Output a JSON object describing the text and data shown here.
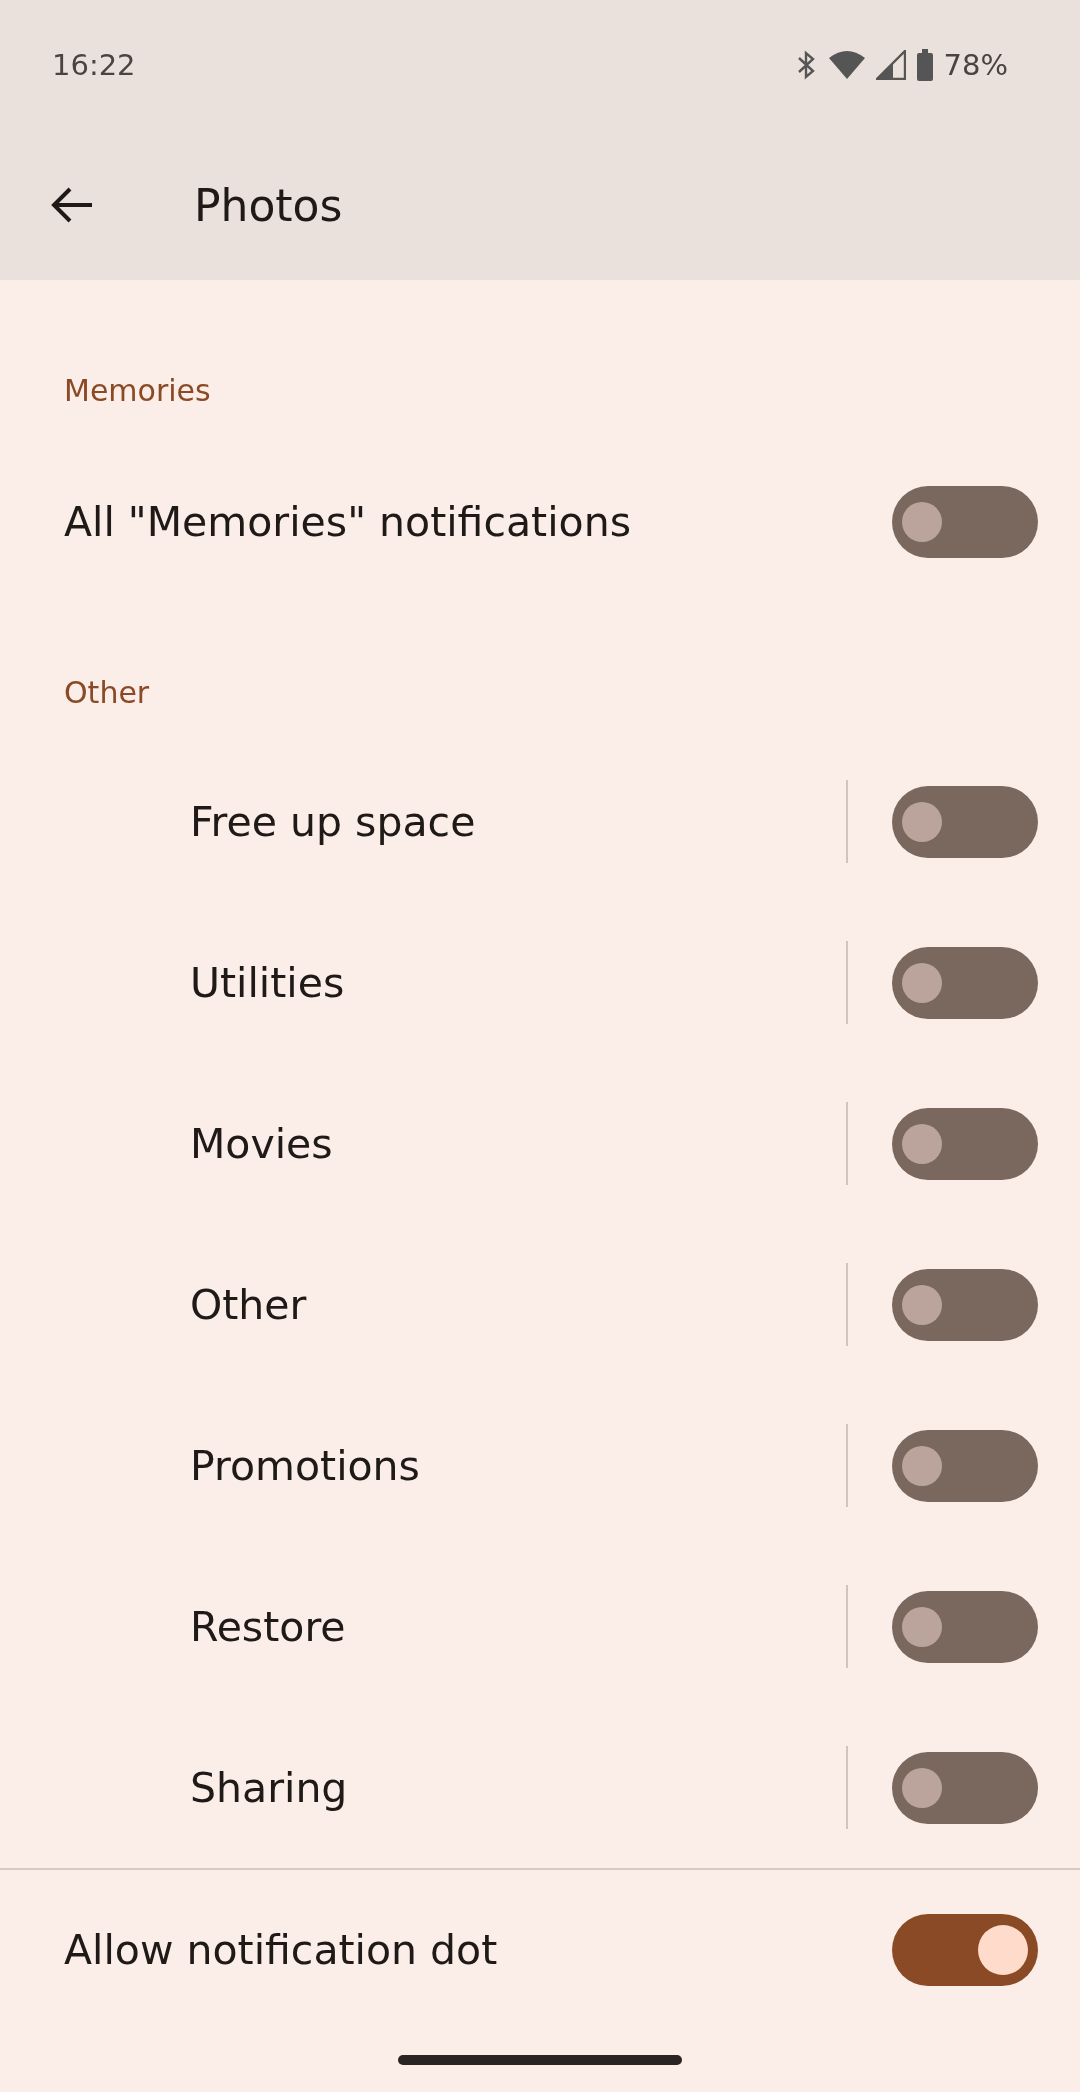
{
  "status_bar": {
    "time": "16:22",
    "battery": "78%"
  },
  "app_bar": {
    "title": "Photos"
  },
  "sections": [
    {
      "header": "Memories",
      "items": [
        {
          "label": "All \"Memories\" notifications",
          "on": false,
          "kind": "plain"
        }
      ]
    },
    {
      "header": "Other",
      "items": [
        {
          "label": "Free up space",
          "on": false,
          "kind": "channel"
        },
        {
          "label": "Utilities",
          "on": false,
          "kind": "channel"
        },
        {
          "label": "Movies",
          "on": false,
          "kind": "channel"
        },
        {
          "label": "Other",
          "on": false,
          "kind": "channel"
        },
        {
          "label": "Promotions",
          "on": false,
          "kind": "channel"
        },
        {
          "label": "Restore",
          "on": false,
          "kind": "channel"
        },
        {
          "label": "Sharing",
          "on": false,
          "kind": "channel"
        }
      ]
    }
  ],
  "footer": {
    "label": "Allow notification dot",
    "on": true
  }
}
